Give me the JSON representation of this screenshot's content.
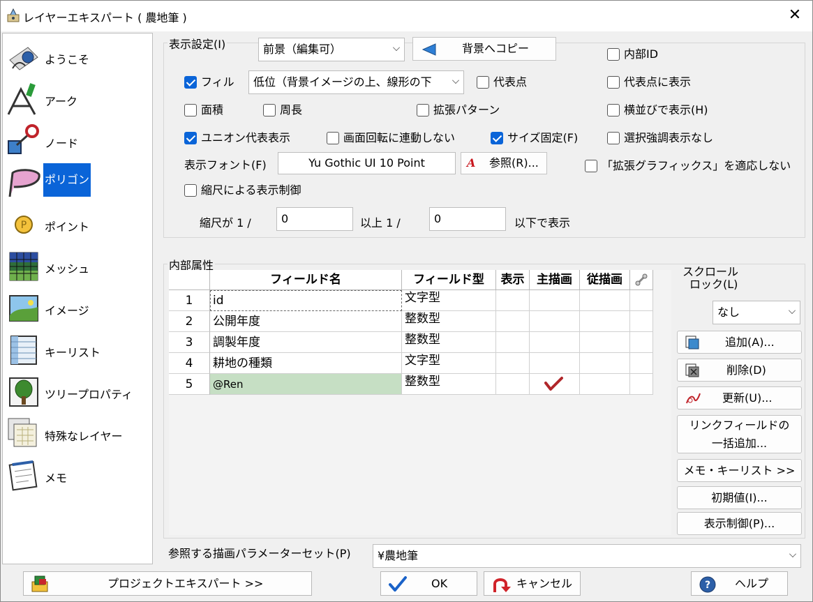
{
  "window": {
    "title": "レイヤーエキスパート ( 農地筆 )"
  },
  "sidebar": {
    "items": [
      {
        "label": "ようこそ",
        "icon": "welcome-icon"
      },
      {
        "label": "アーク",
        "icon": "arc-icon"
      },
      {
        "label": "ノード",
        "icon": "node-icon"
      },
      {
        "label": "ポリゴン",
        "icon": "polygon-icon",
        "selected": true
      },
      {
        "label": "ポイント",
        "icon": "point-icon"
      },
      {
        "label": "メッシュ",
        "icon": "mesh-icon"
      },
      {
        "label": "イメージ",
        "icon": "image-icon"
      },
      {
        "label": "キーリスト",
        "icon": "keylist-icon"
      },
      {
        "label": "ツリープロパティ",
        "icon": "tree-icon"
      },
      {
        "label": "特殊なレイヤー",
        "icon": "special-layer-icon"
      },
      {
        "label": "メモ",
        "icon": "memo-icon"
      }
    ]
  },
  "display": {
    "group_title": "表示設定(I)",
    "layer_select": "前景（編集可）",
    "copy_button": "背景へコピー",
    "fill_label": "フィル",
    "fill_checked": true,
    "fill_order_select": "低位（背景イメージの上、線形の下",
    "rep_point": "代表点",
    "area": "面積",
    "perimeter": "周長",
    "ext_pattern": "拡張パターン",
    "union_rep": "ユニオン代表表示",
    "union_rep_checked": true,
    "no_rotate": "画面回転に連動しない",
    "size_fixed": "サイズ固定(F)",
    "size_fixed_checked": true,
    "internal_id": "内部ID",
    "show_at_rep": "代表点に表示",
    "horizontal": "横並びで表示(H)",
    "no_highlight": "選択強調表示なし",
    "no_ext_graphics": "「拡張グラフィックス」を適応しない",
    "font_label": "表示フォント(F)",
    "font_value": "Yu Gothic UI 10 Point",
    "browse_button": "参照(R)...",
    "scale_control": "縮尺による表示制御",
    "scale_prefix": "縮尺が 1 /",
    "scale_min": "0",
    "scale_mid": "以上 1 /",
    "scale_max": "0",
    "scale_suffix": "以下で表示"
  },
  "attributes": {
    "group_title": "内部属性",
    "columns": [
      "フィールド名",
      "フィールド型",
      "表示",
      "主描画",
      "従描画"
    ],
    "rows": [
      {
        "no": "1",
        "name": "id",
        "type": "文字型"
      },
      {
        "no": "2",
        "name": "公開年度",
        "type": "整数型"
      },
      {
        "no": "3",
        "name": "調製年度",
        "type": "整数型"
      },
      {
        "no": "4",
        "name": "耕地の種類",
        "type": "文字型"
      },
      {
        "no": "5",
        "name": "@Ren",
        "type": "整数型",
        "main_draw": true
      }
    ],
    "scroll_lock_label_1": "スクロール",
    "scroll_lock_label_2": "ロック(L)",
    "scroll_lock_value": "なし",
    "add_button": "追加(A)...",
    "delete_button": "削除(D)",
    "update_button": "更新(U)...",
    "link_button_1": "リンクフィールドの",
    "link_button_2": "一括追加...",
    "memo_keylist_button": "メモ・キーリスト >>",
    "initial_button": "初期値(I)...",
    "display_control_button": "表示制御(P)..."
  },
  "param_set": {
    "label": "参照する描画パラメーターセット(P)",
    "value": "¥農地筆"
  },
  "footer": {
    "project_button": "プロジェクトエキスパート >>",
    "ok_button": "OK",
    "cancel_button": "キャンセル",
    "help_button": "ヘルプ"
  },
  "colors": {
    "accent": "#0a64d8",
    "selected_row_cell": "#c6dfc4",
    "check_mark": "#b0262a"
  }
}
